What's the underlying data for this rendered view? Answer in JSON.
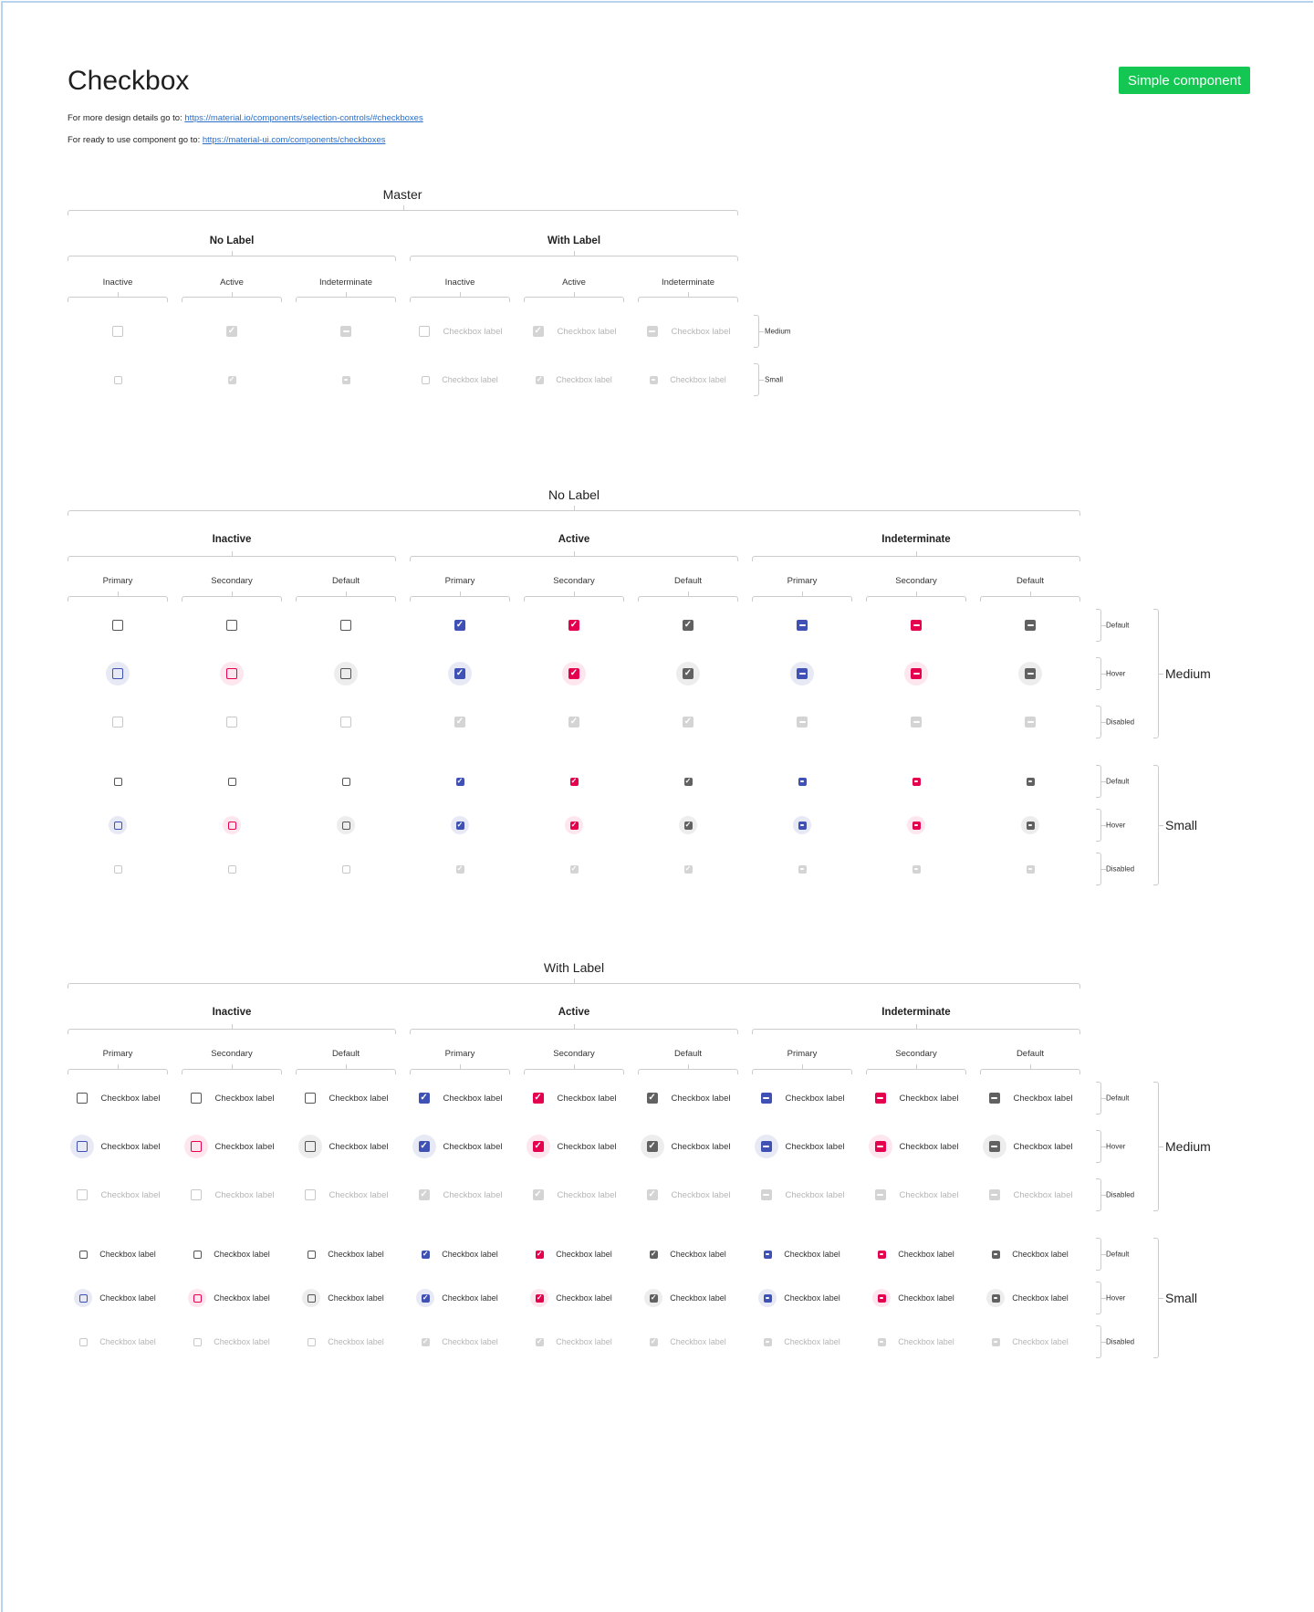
{
  "header": {
    "title": "Checkbox",
    "badge": "Simple component",
    "design_prefix": "For more design details go to: ",
    "design_link": "https://material.io/components/selection-controls/#checkboxes",
    "ready_prefix": "For ready to use component go to: ",
    "ready_link": "https://material-ui.com/components/checkboxes"
  },
  "master": {
    "title": "Master",
    "groups": [
      "No Label",
      "With Label"
    ],
    "columns": [
      "Inactive",
      "Active",
      "Indeterminate",
      "Inactive",
      "Active",
      "Indeterminate"
    ],
    "sizes": [
      "Medium",
      "Small"
    ],
    "checkbox_label": "Checkbox label"
  },
  "no_label": {
    "title": "No Label",
    "groups": [
      "Inactive",
      "Active",
      "Indeterminate"
    ],
    "columns": [
      "Primary",
      "Secondary",
      "Default",
      "Primary",
      "Secondary",
      "Default",
      "Primary",
      "Secondary",
      "Default"
    ],
    "states": [
      "Default",
      "Hover",
      "Disabled"
    ],
    "sizes": [
      "Medium",
      "Small"
    ]
  },
  "with_label": {
    "title": "With Label",
    "groups": [
      "Inactive",
      "Active",
      "Indeterminate"
    ],
    "columns": [
      "Primary",
      "Secondary",
      "Default",
      "Primary",
      "Secondary",
      "Default",
      "Primary",
      "Secondary",
      "Default"
    ],
    "states": [
      "Default",
      "Hover",
      "Disabled"
    ],
    "sizes": [
      "Medium",
      "Small"
    ],
    "checkbox_label": "Checkbox label"
  },
  "colors": {
    "primary": "#3f51b5",
    "secondary": "#e5004f",
    "default": "#616161",
    "disabled": "#c8c8c8",
    "badge": "#13c752",
    "link": "#2a6fc9"
  },
  "icons": {
    "checked": "check-icon",
    "indeterminate": "minus-icon"
  }
}
